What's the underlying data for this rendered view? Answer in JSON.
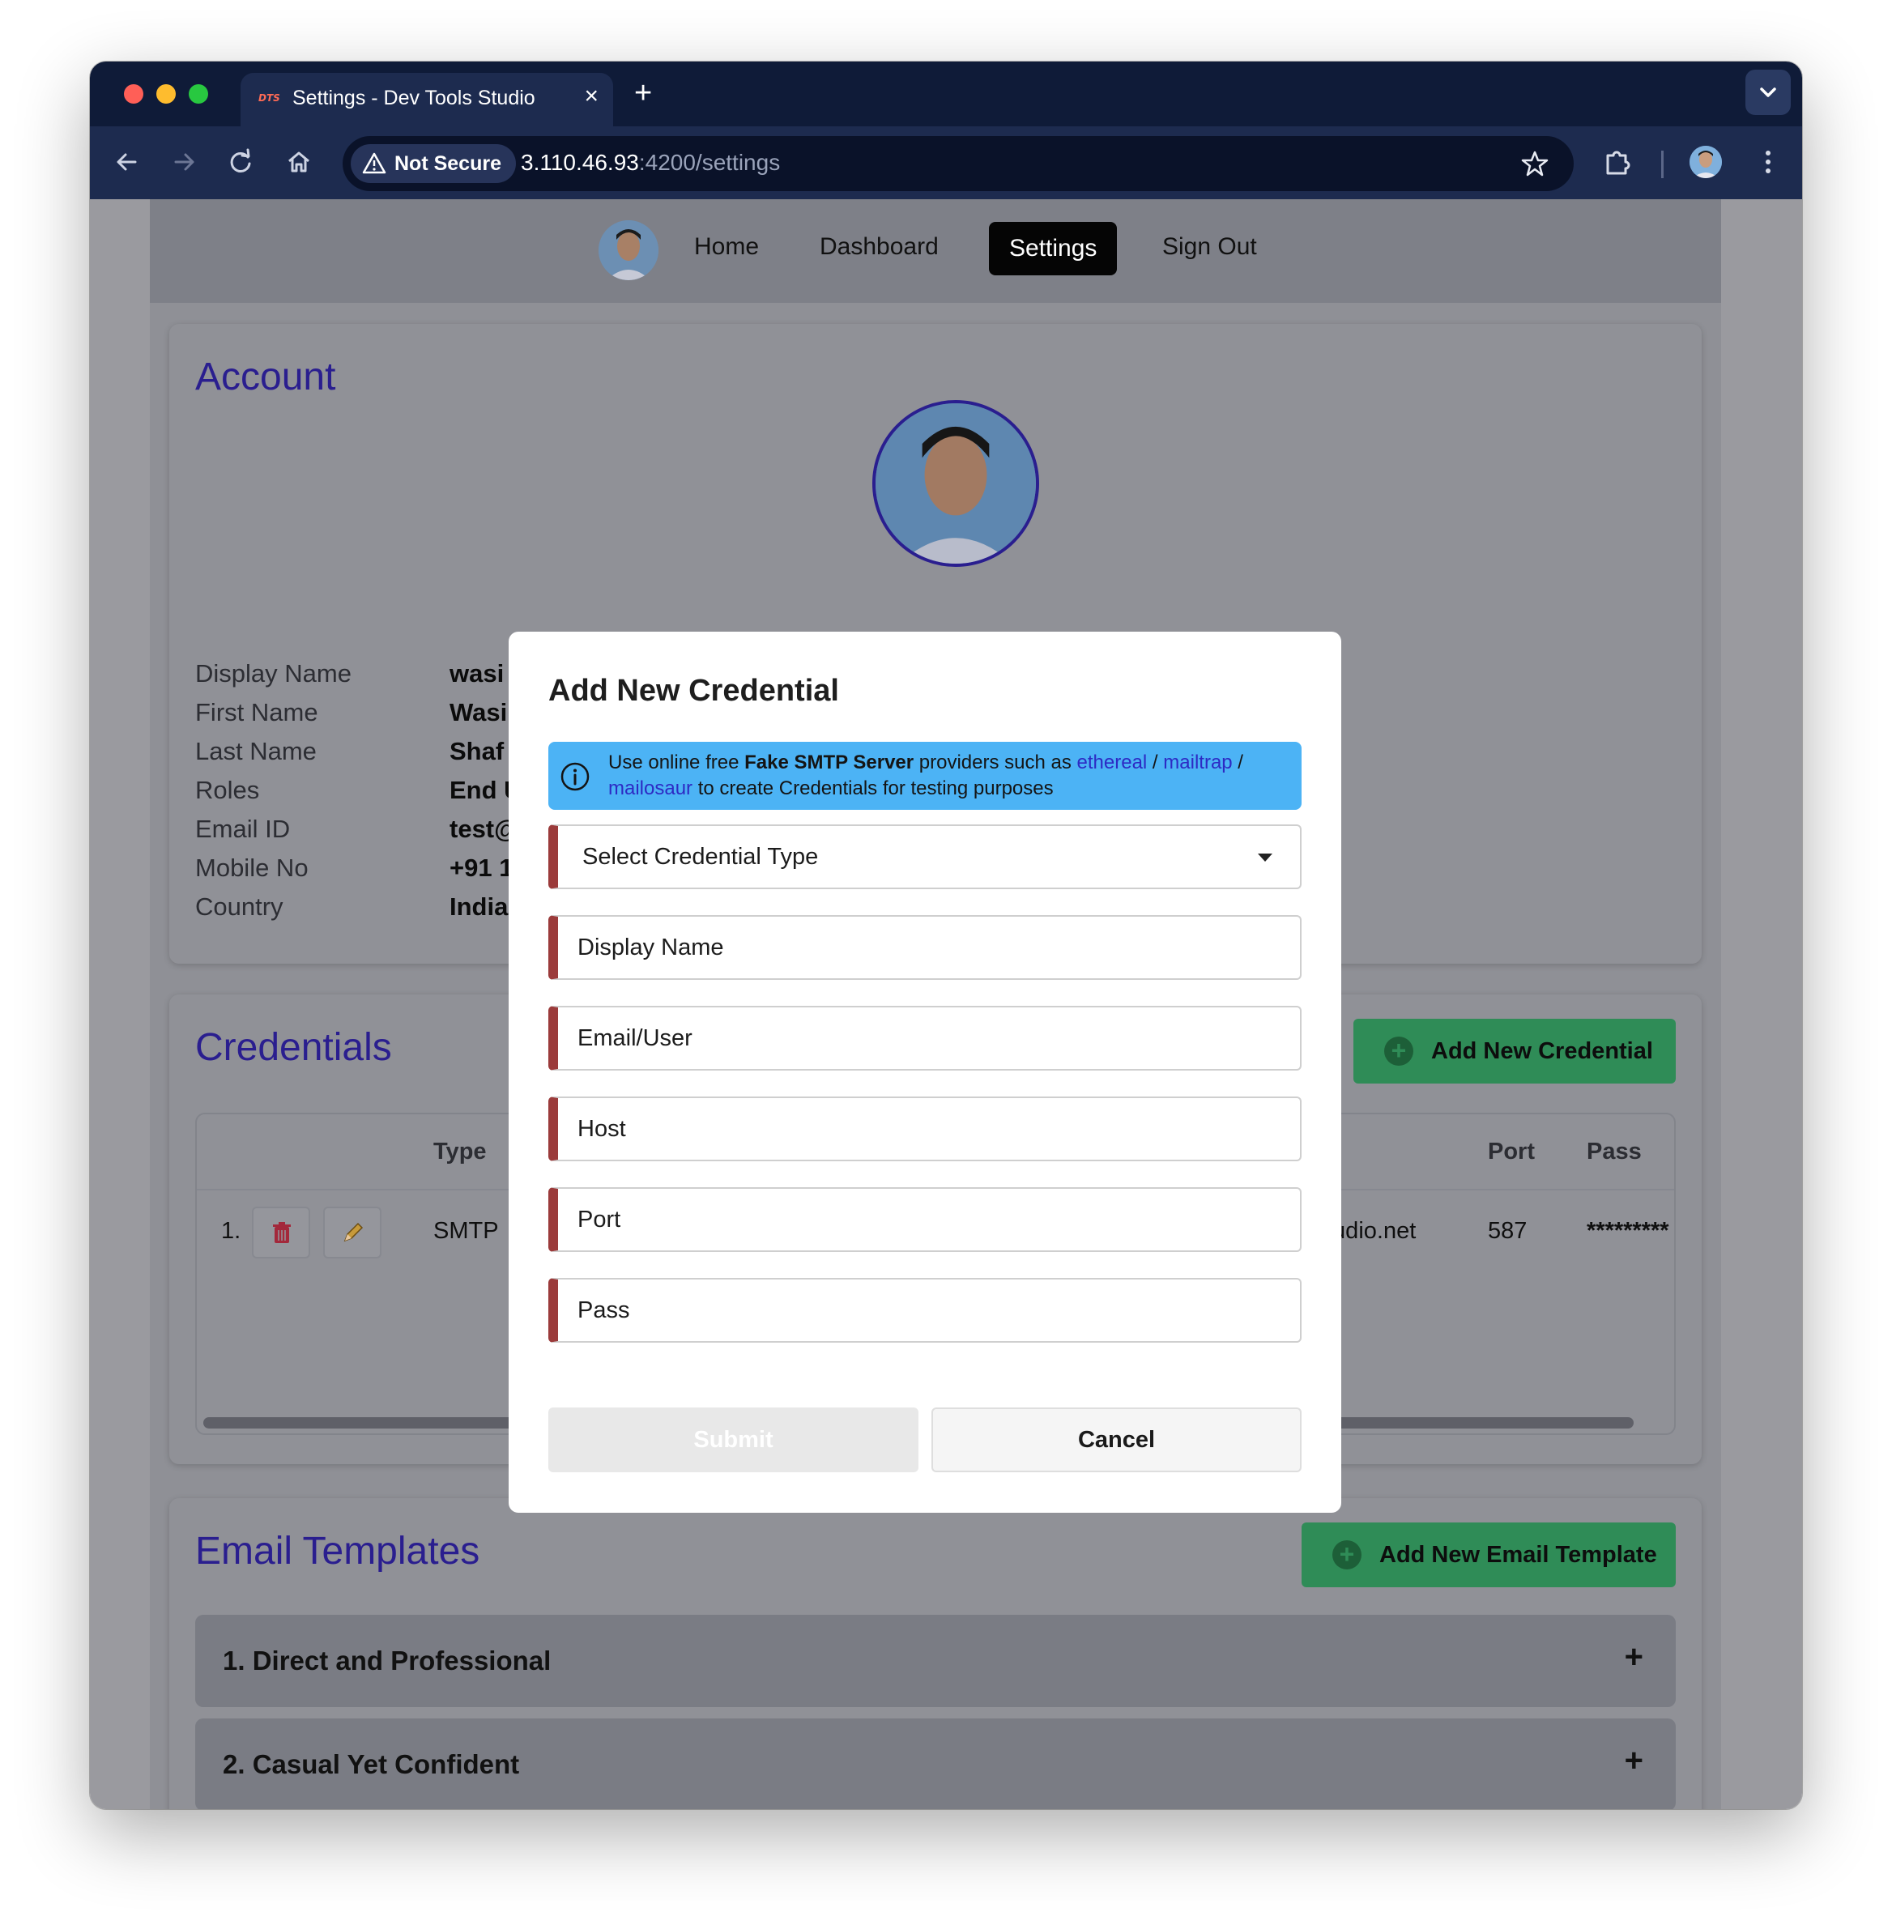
{
  "browser": {
    "tab_title": "Settings - Dev Tools Studio",
    "favicon_text": "DTS",
    "not_secure_label": "Not Secure",
    "url_host": "3.110.46.93",
    "url_path": ":4200/settings"
  },
  "nav": {
    "links": [
      "Home",
      "Dashboard",
      "Settings",
      "Sign Out"
    ],
    "active": "Settings"
  },
  "account": {
    "title": "Account",
    "rows": [
      {
        "label": "Display Name",
        "value": "wasi"
      },
      {
        "label": "First Name",
        "value": "Wasi"
      },
      {
        "label": "Last Name",
        "value": "Shaf"
      },
      {
        "label": "Roles",
        "value": "End U"
      },
      {
        "label": "Email ID",
        "value": "test@"
      },
      {
        "label": "Mobile No",
        "value": "+91 1"
      },
      {
        "label": "Country",
        "value": "India"
      }
    ]
  },
  "credentials": {
    "title": "Credentials",
    "add_button": "Add New Credential",
    "headers": {
      "type": "Type",
      "port": "Port",
      "pass": "Pass"
    },
    "rows": [
      {
        "index": "1.",
        "type": "SMTP",
        "host_partial": "tudio.net",
        "port": "587",
        "pass": "*********"
      }
    ]
  },
  "email_templates": {
    "title": "Email Templates",
    "add_button": "Add New Email Template",
    "items": [
      "1. Direct and Professional",
      "2. Casual Yet Confident"
    ]
  },
  "modal": {
    "title": "Add New Credential",
    "alert": {
      "prefix": "Use online free ",
      "bold": "Fake SMTP Server",
      "middle": " providers such as ",
      "link1": "ethereal",
      "slash1": " / ",
      "link2": "mailtrap",
      "slash2": " /",
      "link3": "mailosaur",
      "suffix": " to create Credentials for testing purposes"
    },
    "select_placeholder": "Select Credential Type",
    "fields": [
      "Display Name",
      "Email/User",
      "Host",
      "Port",
      "Pass"
    ],
    "submit_label": "Submit",
    "cancel_label": "Cancel"
  },
  "colors": {
    "accent_title": "#2a1e8f",
    "success_button": "#2f8c57",
    "required_bar": "#9b3b3b",
    "info_alert": "#4cb3f5"
  }
}
